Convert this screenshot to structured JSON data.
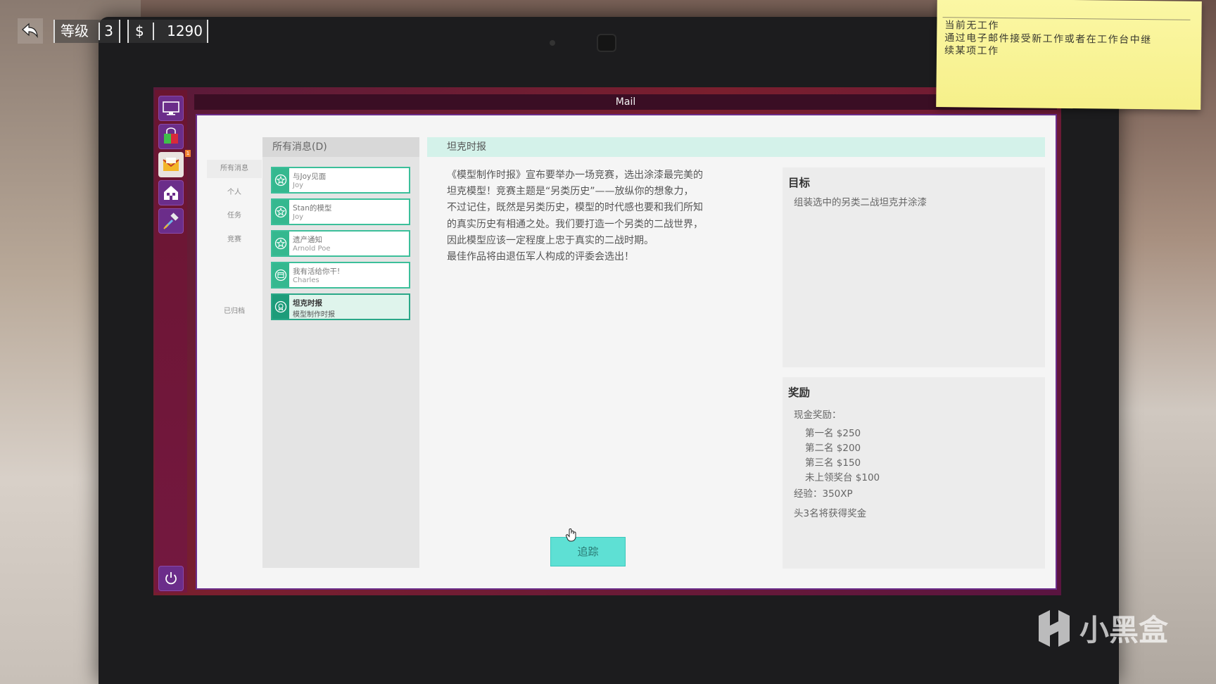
{
  "hud": {
    "level_label": "等级",
    "level_value": "3",
    "currency_symbol": "$",
    "money": "1290"
  },
  "sticky_note": {
    "lines": [
      "当前无工作",
      "通过电子邮件接受新工作或者在工作台中继",
      "续某项工作"
    ]
  },
  "window": {
    "title": "Mail"
  },
  "launcher": {
    "items": [
      {
        "icon": "monitor-icon"
      },
      {
        "icon": "shopping-bag-icon"
      },
      {
        "icon": "mail-icon",
        "badge": "1"
      },
      {
        "icon": "home-icon"
      },
      {
        "icon": "hammer-icon"
      }
    ],
    "power_icon": "power-icon"
  },
  "folders": [
    "所有消息",
    "个人",
    "任务",
    "竞赛",
    "已归档"
  ],
  "message_list": {
    "header": "所有消息(D)",
    "messages": [
      {
        "title": "与Joy见面",
        "from": "Joy",
        "icon": "star-badge-icon"
      },
      {
        "title": "Stan的模型",
        "from": "Joy",
        "icon": "star-badge-icon"
      },
      {
        "title": "遗产通知",
        "from": "Arnold Poe",
        "icon": "star-badge-icon"
      },
      {
        "title": "我有活给你干!",
        "from": "Charles",
        "icon": "calendar-icon"
      },
      {
        "title": "坦克时报",
        "from": "模型制作时报",
        "icon": "trophy-icon"
      }
    ]
  },
  "detail": {
    "title": "坦克时报",
    "body_lines": [
      "《模型制作时报》宣布要举办一场竞赛，选出涂漆最完美的",
      "坦克模型！竞赛主题是“另类历史”——放纵你的想象力，",
      "不过记住，既然是另类历史，模型的时代感也要和我们所知",
      "的真实历史有相通之处。我们要打造一个另类的二战世界，",
      "因此模型应该一定程度上忠于真实的二战时期。",
      "最佳作品将由退伍军人构成的评委会选出！"
    ],
    "goal": {
      "title": "目标",
      "text": "组装选中的另类二战坦克并涂漆"
    },
    "reward": {
      "title": "奖励",
      "cash_label": "现金奖励：",
      "prizes": [
        "第一名 $250",
        "第二名 $200",
        "第三名 $150",
        "未上领奖台 $100"
      ],
      "xp": "经验：350XP",
      "note": "头3名将获得奖金"
    },
    "track_button": "追踪"
  },
  "watermark": "小黑盒",
  "colors": {
    "accent_teal": "#35b88f",
    "button_cyan": "#5ee0d4",
    "launcher_purple": "#6b2d8a",
    "titlebar": "#3a0e24"
  }
}
